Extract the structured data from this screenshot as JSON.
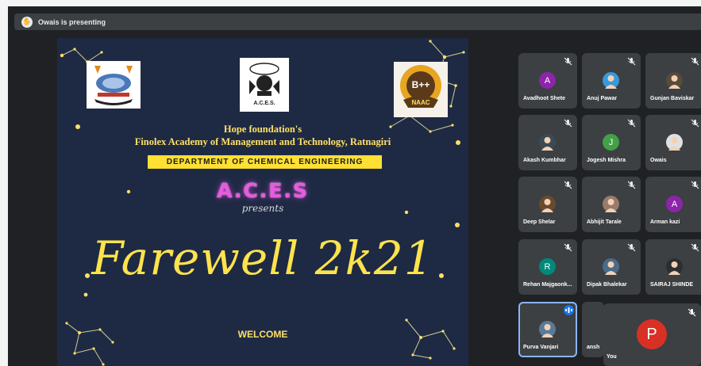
{
  "presenter_bar": {
    "text": "Owais is presenting",
    "icon": "hand-icon"
  },
  "slide": {
    "logos": [
      {
        "name": "institution-crest-logo"
      },
      {
        "name": "aces-logo",
        "caption": "A.C.E.S."
      },
      {
        "name": "naac-badge-logo",
        "grade": "B++",
        "label": "NAAC"
      }
    ],
    "line1": "Hope foundation's",
    "line2": "Finolex Academy of Management and Technology, Ratnagiri",
    "department": "DEPARTMENT OF CHEMICAL ENGINEERING",
    "aces": "A.C.E.S",
    "presents": "presents",
    "headline": "Farewell 2k21",
    "welcome": "WELCOME"
  },
  "participants": [
    {
      "name": "Avadhoot Shete",
      "avatar": "A",
      "color": "#8e24aa",
      "photo": false
    },
    {
      "name": "Anuj Pawar",
      "avatar": "",
      "color": "#3a9ad9",
      "photo": true
    },
    {
      "name": "Gunjan Baviskar",
      "avatar": "",
      "color": "#5a4a3a",
      "photo": true
    },
    {
      "name": "Akash Kumbhar",
      "avatar": "",
      "color": "#3d4a55",
      "photo": true
    },
    {
      "name": "Jogesh Mishra",
      "avatar": "J",
      "color": "#43a047",
      "photo": false
    },
    {
      "name": "Owais",
      "avatar": "",
      "color": "#e0e0e0",
      "photo": true
    },
    {
      "name": "Deep Shelar",
      "avatar": "",
      "color": "#6b4a2b",
      "photo": true
    },
    {
      "name": "Abhijit Tarale",
      "avatar": "",
      "color": "#9a7a6a",
      "photo": true
    },
    {
      "name": "Arman kazi",
      "avatar": "A",
      "color": "#8e24aa",
      "photo": false
    },
    {
      "name": "Rehan Majgaonk...",
      "avatar": "R",
      "color": "#00897b",
      "photo": false
    },
    {
      "name": "Dipak Bhalekar",
      "avatar": "",
      "color": "#4a6a8a",
      "photo": true
    },
    {
      "name": "SAIRAJ SHINDE",
      "avatar": "",
      "color": "#2e2e2e",
      "photo": true
    },
    {
      "name": "Purva Vanjari",
      "avatar": "",
      "color": "#5a7a9a",
      "photo": true,
      "speaking": true
    },
    {
      "name": "ansh",
      "avatar": "",
      "color": "#3c4043",
      "photo": false,
      "partial": true
    }
  ],
  "self_view": {
    "label": "You",
    "avatar": "P",
    "color": "#d93025"
  },
  "colors": {
    "meet_bg": "#202124",
    "tile_bg": "#3c4043",
    "slide_bg": "#1e2a44",
    "accent": "#ffe033"
  }
}
